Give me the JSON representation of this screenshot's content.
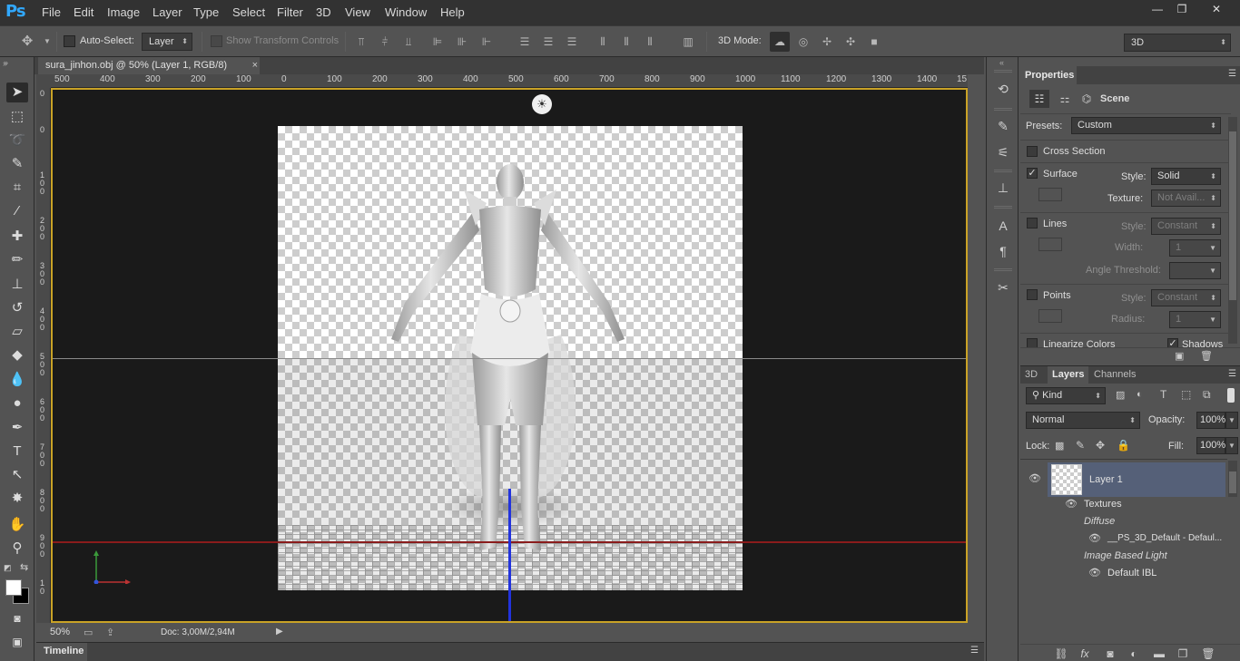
{
  "app": {
    "logo": "Ps",
    "menu": [
      "File",
      "Edit",
      "Image",
      "Layer",
      "Type",
      "Select",
      "Filter",
      "3D",
      "View",
      "Window",
      "Help"
    ],
    "window_controls": [
      "—",
      "❐",
      "✕"
    ]
  },
  "options": {
    "auto_select_label": "Auto-Select:",
    "auto_select_value": "Layer",
    "show_transform_label": "Show Transform Controls",
    "mode_label": "3D Mode:",
    "workspace_value": "3D"
  },
  "document": {
    "tab_title": "sura_jinhon.obj @ 50% (Layer 1, RGB/8)",
    "tab_close": "×",
    "ruler_h": [
      "500",
      "400",
      "300",
      "200",
      "100",
      "0",
      "100",
      "200",
      "300",
      "400",
      "500",
      "600",
      "700",
      "800",
      "900",
      "1000",
      "1100",
      "1200",
      "1300",
      "1400",
      "15"
    ],
    "ruler_v": [
      "0",
      "0",
      "1 0 0",
      "2 0 0",
      "3 0 0",
      "4 0 0",
      "5 0 0",
      "6 0 0",
      "7 0 0",
      "8 0 0",
      "9 0 0",
      "1 0"
    ],
    "zoom": "50%",
    "doc_info": "Doc: 3,00M/2,94M",
    "timeline_label": "Timeline"
  },
  "properties": {
    "title": "Properties",
    "mode_label": "Scene",
    "presets_label": "Presets:",
    "presets_value": "Custom",
    "cross_section_label": "Cross Section",
    "surface_label": "Surface",
    "surface_checked": true,
    "surface_style_label": "Style:",
    "surface_style_value": "Solid",
    "surface_texture_label": "Texture:",
    "surface_texture_value": "Not Avail...",
    "lines_label": "Lines",
    "lines_style_label": "Style:",
    "lines_style_value": "Constant",
    "lines_width_label": "Width:",
    "lines_width_value": "1",
    "angle_threshold_label": "Angle Threshold:",
    "points_label": "Points",
    "points_style_label": "Style:",
    "points_style_value": "Constant",
    "points_radius_label": "Radius:",
    "points_radius_value": "1",
    "linearize_label": "Linearize Colors",
    "shadows_label": "Shadows",
    "shadows_checked": true
  },
  "layers": {
    "tabs": [
      "3D",
      "Layers",
      "Channels"
    ],
    "active_tab": "Layers",
    "kind_label": "Kind",
    "blend_mode": "Normal",
    "opacity_label": "Opacity:",
    "opacity_value": "100%",
    "lock_label": "Lock:",
    "fill_label": "Fill:",
    "fill_value": "100%",
    "layer_name": "Layer 1",
    "textures_label": "Textures",
    "diffuse_label": "Diffuse",
    "diffuse_texture": "__PS_3D_Default - Defaul...",
    "ibl_label": "Image Based Light",
    "ibl_value": "Default IBL"
  },
  "colors": {
    "active_frame": "#c9a226",
    "selected_layer": "#556078",
    "ps_blue": "#31a8ff"
  }
}
